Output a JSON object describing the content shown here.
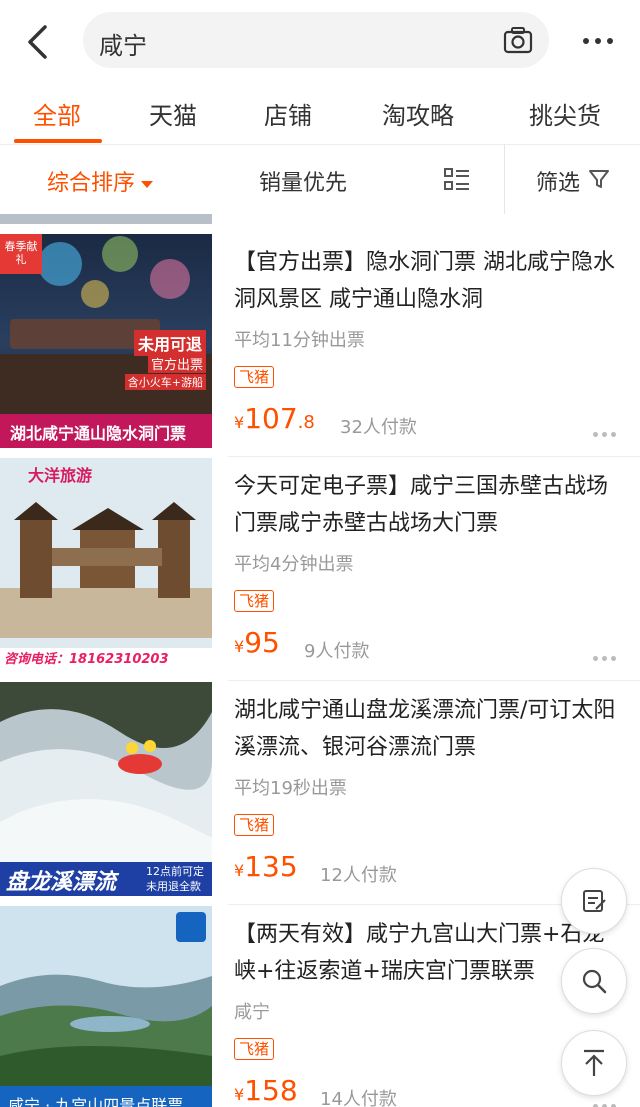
{
  "search": {
    "query": "咸宁"
  },
  "tabs": [
    "全部",
    "天猫",
    "店铺",
    "淘攻略",
    "挑尖货"
  ],
  "sort": {
    "comprehensive": "综合排序",
    "sales": "销量优先",
    "filter": "筛选"
  },
  "colors": {
    "accent": "#ff5000"
  },
  "products": [
    {
      "title": "【官方出票】隐水洞门票 湖北咸宁隐水洞风景区 咸宁通山隐水洞",
      "subtitle": "平均11分钟出票",
      "tag": "飞猪",
      "price_int": "107",
      "price_dec": ".8",
      "sold": "32人付款",
      "img": {
        "badge": "春季献礼",
        "line1": "未用可退",
        "line2": "官方出票",
        "line3": "含小火车+游船",
        "caption": "湖北咸宁通山隐水洞门票"
      }
    },
    {
      "title": "今天可定电子票】咸宁三国赤壁古战场门票咸宁赤壁古战场大门票",
      "subtitle": "平均4分钟出票",
      "tag": "飞猪",
      "price_int": "95",
      "price_dec": "",
      "sold": "9人付款",
      "img": {
        "brand": "大洋旅游",
        "phone": "咨询电话：18162310203"
      }
    },
    {
      "title": "湖北咸宁通山盘龙溪漂流门票/可订太阳溪漂流、银河谷漂流门票",
      "subtitle": "平均19秒出票",
      "tag": "飞猪",
      "price_int": "135",
      "price_dec": "",
      "sold": "12人付款",
      "img": {
        "caption": "盘龙溪漂流",
        "note1": "12点前可定",
        "note2": "未用退全款"
      }
    },
    {
      "title": "【两天有效】咸宁九宫山大门票+石龙峡+往返索道+瑞庆宫门票联票",
      "subtitle": "咸宁",
      "tag": "飞猪",
      "price_int": "158",
      "price_dec": "",
      "sold": "14人付款",
      "img": {
        "caption": "咸宁 · 九宫山四景点联票"
      }
    }
  ]
}
